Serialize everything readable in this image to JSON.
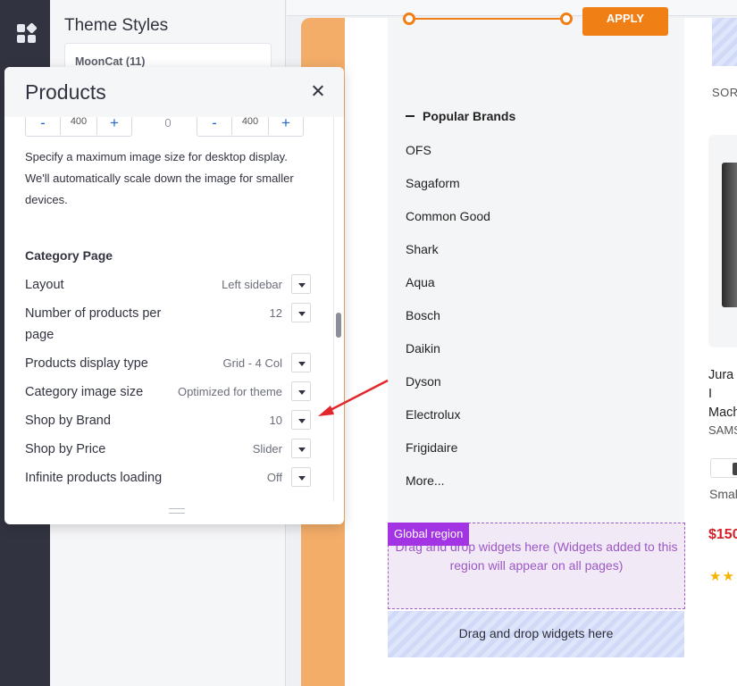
{
  "theme_styles": {
    "title": "Theme Styles",
    "preset": "MoonCat (11)"
  },
  "panel": {
    "title": "Products",
    "image_size": {
      "width": "400",
      "height": "400"
    },
    "description": "Specify a maximum image size for desktop display. We'll automatically scale down the image for smaller devices.",
    "section_title": "Category Page",
    "settings": [
      {
        "label": "Layout",
        "value": "Left sidebar"
      },
      {
        "label": "Number of products per page",
        "value": "12"
      },
      {
        "label": "Products display type",
        "value": "Grid - 4 Col"
      },
      {
        "label": "Category image size",
        "value": "Optimized for theme"
      },
      {
        "label": "Shop by Brand",
        "value": "10"
      },
      {
        "label": "Shop by Price",
        "value": "Slider"
      },
      {
        "label": "Infinite products loading",
        "value": "Off"
      }
    ]
  },
  "storefront": {
    "apply_label": "APPLY",
    "brands_heading": "Popular Brands",
    "brands": [
      "OFS",
      "Sagaform",
      "Common Good",
      "Shark",
      "Aqua",
      "Bosch",
      "Daikin",
      "Dyson",
      "Electrolux",
      "Frigidaire",
      "More..."
    ],
    "global_region_tag": "Global region",
    "global_region_text": "Drag and drop widgets here (Widgets added to this region will appear on all pages)",
    "drop_zone_text": "Drag and drop widgets here",
    "sort_label": "SOR",
    "product": {
      "name_line1": "Jura I",
      "name_line2": "Mach",
      "brand": "SAMS",
      "size": "Smal",
      "price": "$150",
      "stars": "★★"
    }
  },
  "colors": {
    "accent_orange": "#f07f15",
    "global_purple": "#a334e3",
    "price_red": "#d51f26",
    "rail": "#313440"
  }
}
